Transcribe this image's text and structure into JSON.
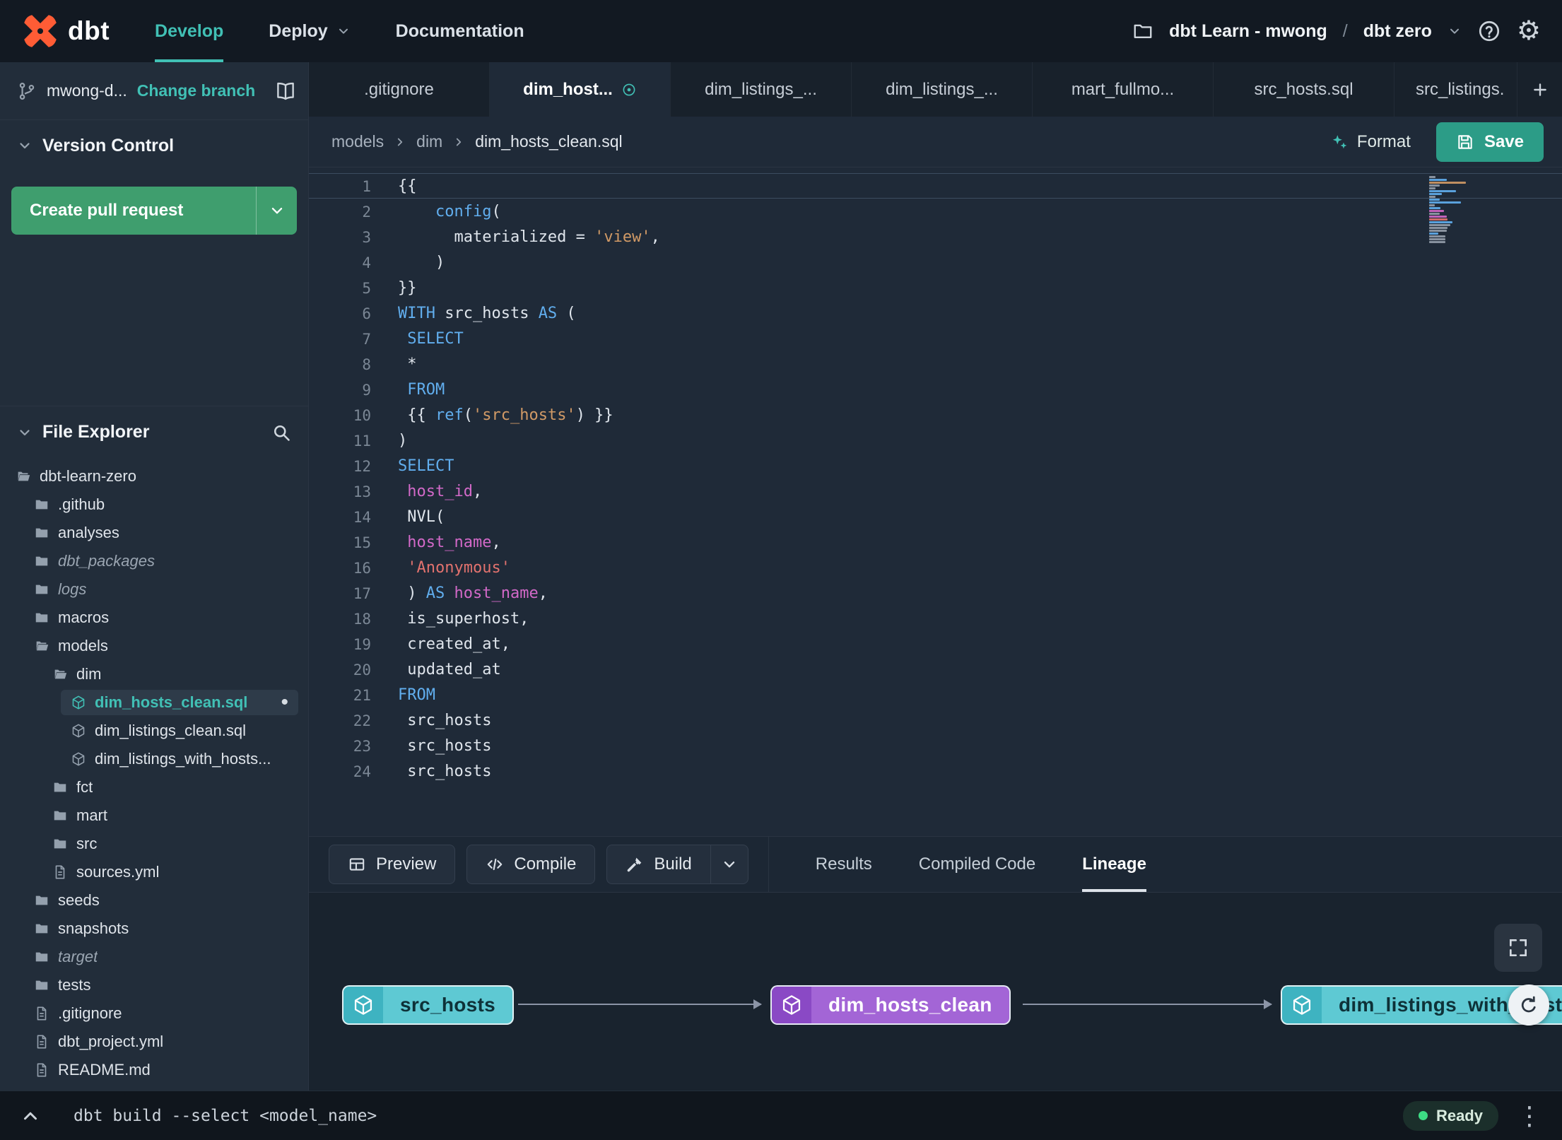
{
  "navbar": {
    "logo_text": "dbt",
    "nav": [
      {
        "label": "Develop",
        "active": true
      },
      {
        "label": "Deploy",
        "caret": true
      },
      {
        "label": "Documentation"
      }
    ],
    "project": "dbt Learn - mwong",
    "separator": "/",
    "environment": "dbt zero"
  },
  "branch_bar": {
    "branch_name": "mwong-d...",
    "change_branch_label": "Change branch"
  },
  "version_control": {
    "header": "Version Control",
    "create_pr_label": "Create pull request"
  },
  "file_explorer": {
    "header": "File Explorer",
    "tree": [
      {
        "label": "dbt-learn-zero",
        "type": "folder-open",
        "depth": 0
      },
      {
        "label": ".github",
        "type": "folder",
        "depth": 1
      },
      {
        "label": "analyses",
        "type": "folder",
        "depth": 1
      },
      {
        "label": "dbt_packages",
        "type": "folder",
        "depth": 1,
        "italic": true
      },
      {
        "label": "logs",
        "type": "folder",
        "depth": 1,
        "italic": true
      },
      {
        "label": "macros",
        "type": "folder",
        "depth": 1
      },
      {
        "label": "models",
        "type": "folder-open",
        "depth": 1
      },
      {
        "label": "dim",
        "type": "folder-open",
        "depth": 2
      },
      {
        "label": "dim_hosts_clean.sql",
        "type": "model",
        "depth": 3,
        "selected": true,
        "modified": true
      },
      {
        "label": "dim_listings_clean.sql",
        "type": "model",
        "depth": 3
      },
      {
        "label": "dim_listings_with_hosts...",
        "type": "model",
        "depth": 3
      },
      {
        "label": "fct",
        "type": "folder",
        "depth": 2
      },
      {
        "label": "mart",
        "type": "folder",
        "depth": 2
      },
      {
        "label": "src",
        "type": "folder",
        "depth": 2
      },
      {
        "label": "sources.yml",
        "type": "file",
        "depth": 2
      },
      {
        "label": "seeds",
        "type": "folder",
        "depth": 1
      },
      {
        "label": "snapshots",
        "type": "folder",
        "depth": 1
      },
      {
        "label": "target",
        "type": "folder",
        "depth": 1,
        "italic": true
      },
      {
        "label": "tests",
        "type": "folder",
        "depth": 1
      },
      {
        "label": ".gitignore",
        "type": "file",
        "depth": 1
      },
      {
        "label": "dbt_project.yml",
        "type": "file",
        "depth": 1
      },
      {
        "label": "README.md",
        "type": "file",
        "depth": 1
      }
    ]
  },
  "editor_tabs": [
    {
      "label": ".gitignore"
    },
    {
      "label": "dim_host...",
      "active": true,
      "modified": true
    },
    {
      "label": "dim_listings_..."
    },
    {
      "label": "dim_listings_..."
    },
    {
      "label": "mart_fullmo..."
    },
    {
      "label": "src_hosts.sql"
    },
    {
      "label": "src_listings.",
      "clipped": true
    }
  ],
  "breadcrumb": [
    "models",
    "dim",
    "dim_hosts_clean.sql"
  ],
  "editor_actions": {
    "format_label": "Format",
    "save_label": "Save"
  },
  "editor": {
    "language": "sql",
    "lines": [
      {
        "n": 1,
        "active": true,
        "tokens": [
          [
            "p",
            "{{"
          ]
        ]
      },
      {
        "n": 2,
        "tokens": [
          [
            "p",
            "    "
          ],
          [
            "k",
            "config"
          ],
          [
            "p",
            "("
          ]
        ]
      },
      {
        "n": 3,
        "tokens": [
          [
            "p",
            "      materialized = "
          ],
          [
            "s",
            "'view'"
          ],
          [
            "p",
            ","
          ]
        ]
      },
      {
        "n": 4,
        "tokens": [
          [
            "p",
            "    )"
          ]
        ]
      },
      {
        "n": 5,
        "tokens": [
          [
            "p",
            "}}"
          ]
        ]
      },
      {
        "n": 6,
        "tokens": [
          [
            "k",
            "WITH"
          ],
          [
            "p",
            " src_hosts "
          ],
          [
            "k",
            "AS"
          ],
          [
            "p",
            " ("
          ]
        ]
      },
      {
        "n": 7,
        "tokens": [
          [
            "p",
            " "
          ],
          [
            "k",
            "SELECT"
          ]
        ]
      },
      {
        "n": 8,
        "tokens": [
          [
            "p",
            " *"
          ]
        ]
      },
      {
        "n": 9,
        "tokens": [
          [
            "p",
            " "
          ],
          [
            "k",
            "FROM"
          ]
        ]
      },
      {
        "n": 10,
        "tokens": [
          [
            "p",
            " {{ "
          ],
          [
            "k",
            "ref"
          ],
          [
            "p",
            "("
          ],
          [
            "s",
            "'src_hosts'"
          ],
          [
            "p",
            ") }}"
          ]
        ]
      },
      {
        "n": 11,
        "tokens": [
          [
            "p",
            ")"
          ]
        ]
      },
      {
        "n": 12,
        "tokens": [
          [
            "k",
            "SELECT"
          ]
        ]
      },
      {
        "n": 13,
        "tokens": [
          [
            "p",
            " "
          ],
          [
            "v",
            "host_id"
          ],
          [
            "p",
            ","
          ]
        ]
      },
      {
        "n": 14,
        "tokens": [
          [
            "p",
            " NVL("
          ]
        ]
      },
      {
        "n": 15,
        "tokens": [
          [
            "p",
            " "
          ],
          [
            "v",
            "host_name"
          ],
          [
            "p",
            ","
          ]
        ]
      },
      {
        "n": 16,
        "tokens": [
          [
            "p",
            " "
          ],
          [
            "s2",
            "'Anonymous'"
          ]
        ]
      },
      {
        "n": 17,
        "tokens": [
          [
            "p",
            " ) "
          ],
          [
            "k",
            "AS"
          ],
          [
            "p",
            " "
          ],
          [
            "v",
            "host_name"
          ],
          [
            "p",
            ","
          ]
        ]
      },
      {
        "n": 18,
        "tokens": [
          [
            "p",
            " is_superhost,"
          ]
        ]
      },
      {
        "n": 19,
        "tokens": [
          [
            "p",
            " created_at,"
          ]
        ]
      },
      {
        "n": 20,
        "tokens": [
          [
            "p",
            " updated_at"
          ]
        ]
      },
      {
        "n": 21,
        "tokens": [
          [
            "k",
            "FROM"
          ]
        ]
      },
      {
        "n": 22,
        "tokens": [
          [
            "p",
            " src_hosts"
          ]
        ]
      },
      {
        "n": 23,
        "tokens": [
          [
            "p",
            " src_hosts"
          ]
        ]
      },
      {
        "n": 24,
        "tokens": [
          [
            "p",
            " src_hosts"
          ]
        ]
      }
    ]
  },
  "panel": {
    "preview_label": "Preview",
    "compile_label": "Compile",
    "build_label": "Build",
    "tabs": [
      {
        "label": "Results"
      },
      {
        "label": "Compiled Code"
      },
      {
        "label": "Lineage",
        "active": true
      }
    ]
  },
  "lineage": {
    "nodes": [
      {
        "label": "src_hosts",
        "color": "teal"
      },
      {
        "label": "dim_hosts_clean",
        "color": "purple"
      },
      {
        "label": "dim_listings_with_hosts",
        "color": "teal",
        "clipped": true
      }
    ]
  },
  "status_bar": {
    "command": "dbt build --select <model_name>",
    "status_label": "Ready"
  },
  "colors": {
    "accent_teal": "#41c0b5",
    "pr_green": "#3f9e6e",
    "save_teal": "#2c9c87",
    "node_teal": "#5ec9d3",
    "node_purple": "#a365d6",
    "logo_orange": "#ff5c35",
    "ready_green": "#3ddc84"
  }
}
